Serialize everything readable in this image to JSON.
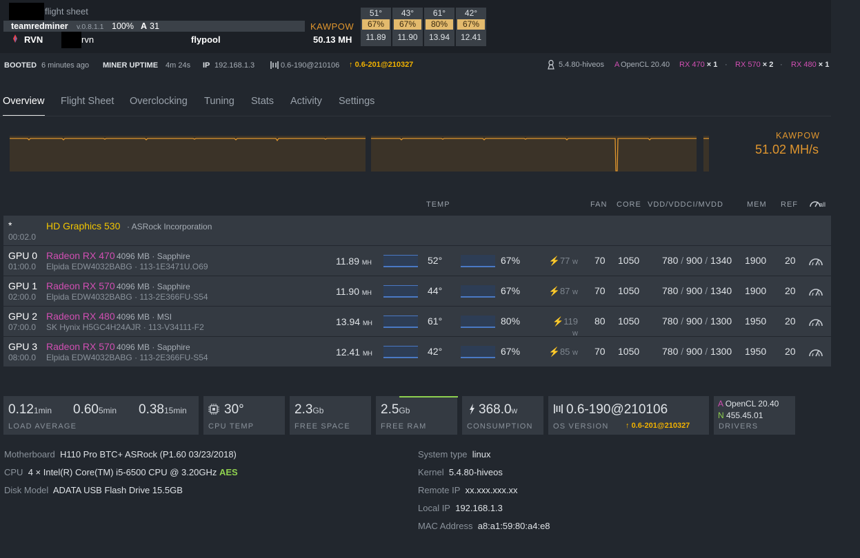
{
  "header": {
    "flight_sheet": "flight sheet",
    "miner": "teamredminer",
    "miner_version": "v.0.8.1.1",
    "miner_percent": "100%",
    "accepted_letter": "A",
    "accepted_count": "31",
    "coin": "RVN",
    "wallet_suffix": "rvn",
    "pool": "flypool",
    "algo": "KAWPOW",
    "hashrate": "50.13 MH"
  },
  "fan_boxes": [
    {
      "temp": "51°",
      "fan": "67%",
      "hash": "11.89"
    },
    {
      "temp": "43°",
      "fan": "67%",
      "hash": "11.90"
    },
    {
      "temp": "61°",
      "fan": "80%",
      "hash": "13.94"
    },
    {
      "temp": "42°",
      "fan": "67%",
      "hash": "12.41"
    }
  ],
  "info_row": {
    "booted_label": "BOOTED",
    "booted_value": "6 minutes ago",
    "uptime_label": "MINER UPTIME",
    "uptime_value": "4m 24s",
    "ip_label": "IP",
    "ip_value": "192.168.1.3",
    "version": "0.6-190@210106",
    "update_version": "0.6-201@210327",
    "kernel": "5.4.80-hiveos",
    "opencl": "OpenCL 20.40",
    "opencl_letter": "A",
    "gpu_summary": [
      {
        "name": "RX 470",
        "count": "× 1"
      },
      {
        "name": "RX 570",
        "count": "× 2"
      },
      {
        "name": "RX 480",
        "count": "× 1"
      }
    ],
    "dot": "·"
  },
  "tabs": [
    "Overview",
    "Flight Sheet",
    "Overclocking",
    "Tuning",
    "Stats",
    "Activity",
    "Settings"
  ],
  "chart": {
    "algo": "KAWPOW",
    "rate": "51.02 MH/s"
  },
  "columns": {
    "temp": "TEMP",
    "fan": "FAN",
    "core": "CORE",
    "vdd": "VDD/VDDCI/MVDD",
    "mem": "MEM",
    "ref": "REF",
    "all": "all"
  },
  "igpu": {
    "star": "*",
    "bus": "00:02.0",
    "name": "HD Graphics 530",
    "vendor": "· ASRock Incorporation"
  },
  "gpus": [
    {
      "id": "GPU 0",
      "bus": "01:00.0",
      "name": "Radeon RX 470",
      "mem": "4096 MB · Sapphire",
      "memchip": "Elpida EDW4032BABG · 113-1E3471U.O69",
      "hash": "11.89",
      "hunit": "MH",
      "temp": "52°",
      "fan": "67%",
      "watt": "77",
      "wunit": "w",
      "fanpct": "70",
      "core": "1050",
      "v1": "780",
      "v2": "900",
      "v3": "1340",
      "memclk": "1900",
      "ref": "20"
    },
    {
      "id": "GPU 1",
      "bus": "02:00.0",
      "name": "Radeon RX 570",
      "mem": "4096 MB · Sapphire",
      "memchip": "Elpida EDW4032BABG · 113-2E366FU-S54",
      "hash": "11.90",
      "hunit": "MH",
      "temp": "44°",
      "fan": "67%",
      "watt": "87",
      "wunit": "w",
      "fanpct": "70",
      "core": "1050",
      "v1": "780",
      "v2": "900",
      "v3": "1340",
      "memclk": "1900",
      "ref": "20"
    },
    {
      "id": "GPU 2",
      "bus": "07:00.0",
      "name": "Radeon RX 480",
      "mem": "4096 MB · MSI",
      "memchip": "SK Hynix H5GC4H24AJR · 113-V34111-F2",
      "hash": "13.94",
      "hunit": "MH",
      "temp": "61°",
      "fan": "80%",
      "watt": "119",
      "wunit": "w",
      "fanpct": "80",
      "core": "1050",
      "v1": "780",
      "v2": "900",
      "v3": "1300",
      "memclk": "1950",
      "ref": "20"
    },
    {
      "id": "GPU 3",
      "bus": "08:00.0",
      "name": "Radeon RX 570",
      "mem": "4096 MB · Sapphire",
      "memchip": "Elpida EDW4032BABG · 113-2E366FU-S54",
      "hash": "12.41",
      "hunit": "MH",
      "temp": "42°",
      "fan": "67%",
      "watt": "85",
      "wunit": "w",
      "fanpct": "70",
      "core": "1050",
      "v1": "780",
      "v2": "900",
      "v3": "1300",
      "memclk": "1950",
      "ref": "20"
    }
  ],
  "stats": {
    "la1": "0.12",
    "la1u": "1min",
    "la5": "0.60",
    "la5u": "5min",
    "la15": "0.38",
    "la15u": "15min",
    "la_cap": "LOAD AVERAGE",
    "cpu_temp": "30°",
    "cpu_cap": "CPU TEMP",
    "free_space": "2.3",
    "free_space_u": "Gb",
    "free_space_cap": "FREE SPACE",
    "free_ram": "2.5",
    "free_ram_u": "Gb",
    "free_ram_cap": "FREE RAM",
    "consumption": "368.0",
    "consumption_u": "w",
    "consumption_cap": "CONSUMPTION",
    "os_version": "0.6-190@210106",
    "os_update": "0.6-201@210327",
    "os_cap": "OS VERSION",
    "drv_a_letter": "A",
    "drv_a": "OpenCL 20.40",
    "drv_n_letter": "N",
    "drv_n": "455.45.01",
    "drv_cap": "DRIVERS"
  },
  "system": {
    "motherboard_label": "Motherboard",
    "motherboard": "H110 Pro BTC+ ASRock (P1.60 03/23/2018)",
    "cpu_label": "CPU",
    "cpu": "4 × Intel(R) Core(TM) i5-6500 CPU @ 3.20GHz",
    "aes": "AES",
    "disk_label": "Disk Model",
    "disk": "ADATA USB Flash Drive 15.5GB",
    "systype_label": "System type",
    "systype": "linux",
    "kernel_label": "Kernel",
    "kernel": "5.4.80-hiveos",
    "remoteip_label": "Remote IP",
    "remoteip": "xx.xxx.xxx.xx",
    "localip_label": "Local IP",
    "localip": "192.168.1.3",
    "mac_label": "MAC Address",
    "mac": "a8:a1:59:80:a4:e8"
  }
}
